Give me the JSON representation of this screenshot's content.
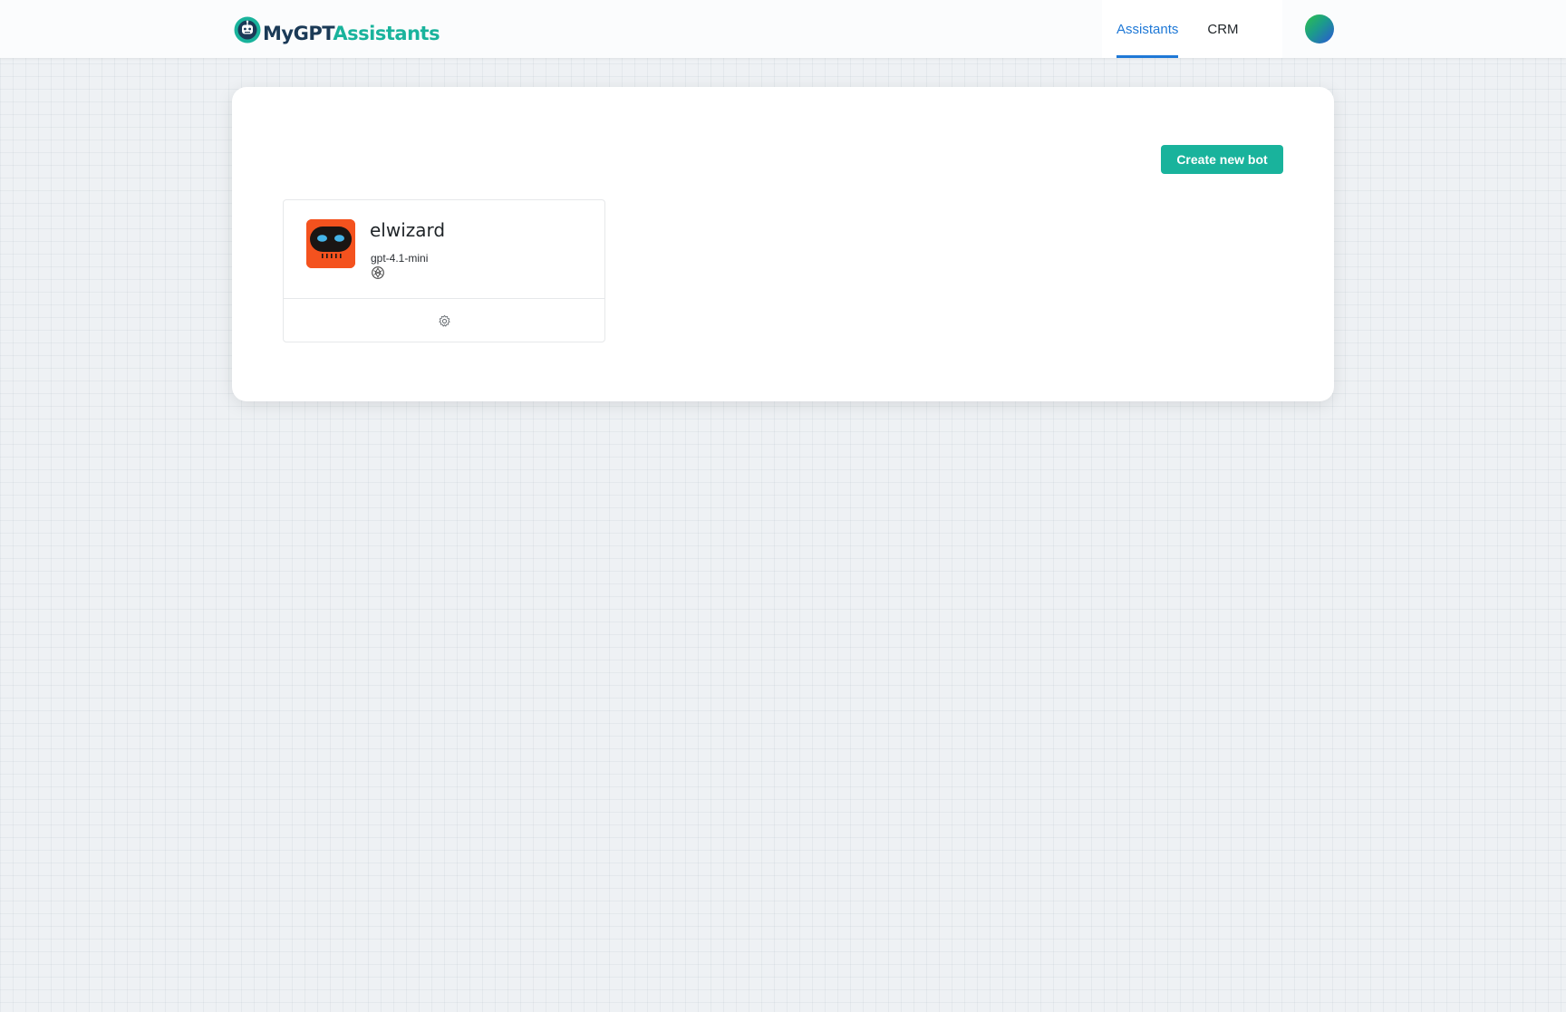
{
  "header": {
    "logo": {
      "part1": "MyGPT",
      "part2": "Assistants",
      "icon": "robot-logo-icon"
    },
    "nav": [
      {
        "label": "Assistants",
        "active": true
      },
      {
        "label": "CRM",
        "active": false
      }
    ],
    "user_avatar": {
      "icon": "user-avatar"
    }
  },
  "main": {
    "create_button": {
      "label": "Create new bot"
    },
    "bots": [
      {
        "name": "elwizard",
        "model": "gpt-4.1-mini",
        "provider_icon": "openai-icon",
        "settings_icon": "gear-icon"
      }
    ]
  },
  "colors": {
    "accent": "#19b39c",
    "nav_active": "#1e78d6",
    "logo_dark": "#1b3a57",
    "bot_avatar_bg": "#f4521e"
  }
}
